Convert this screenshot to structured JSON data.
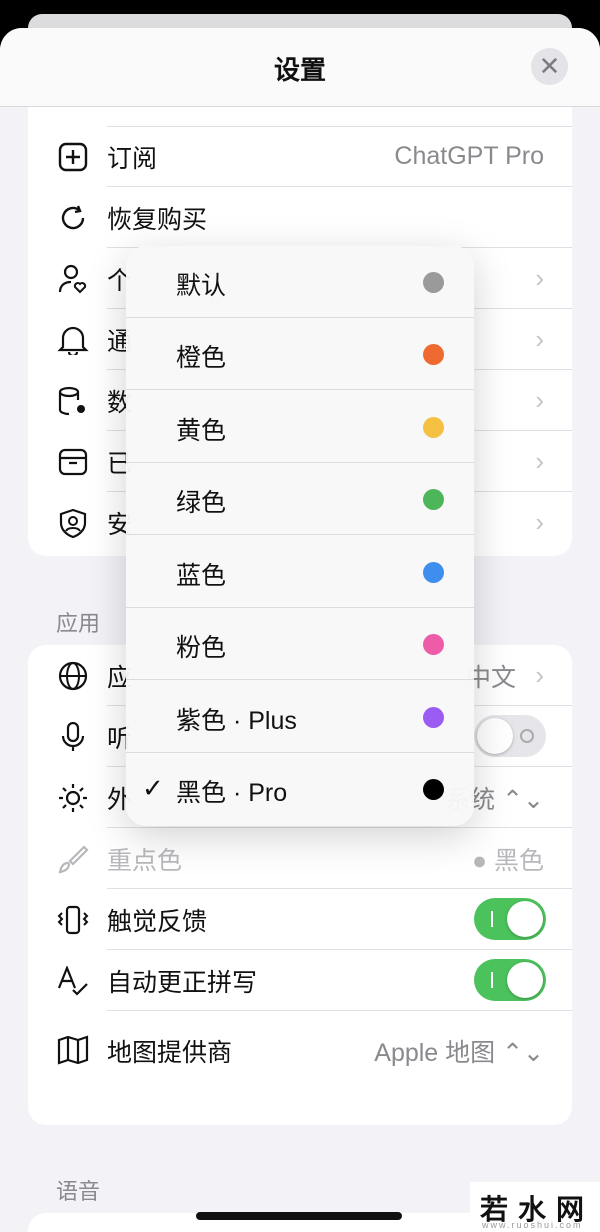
{
  "nav": {
    "title": "设置",
    "close_symbol": "✕"
  },
  "account_rows": [
    {
      "icon": "plus-square-icon",
      "label": "订阅",
      "value": "ChatGPT Pro"
    },
    {
      "icon": "refresh-icon",
      "label": "恢复购买"
    },
    {
      "icon": "personalization-icon",
      "label": "个"
    },
    {
      "icon": "bell-icon",
      "label": "通"
    },
    {
      "icon": "database-gear-icon",
      "label": "数"
    },
    {
      "icon": "archive-icon",
      "label": "已"
    },
    {
      "icon": "shield-icon",
      "label": "安"
    }
  ],
  "chevron": "›",
  "app_section": {
    "title": "应用",
    "rows": [
      {
        "icon": "globe-icon",
        "label": "应",
        "value": "中文"
      },
      {
        "icon": "microphone-icon",
        "label": "听"
      },
      {
        "icon": "sun-icon",
        "label": "外",
        "value": "系统 ⌃⌄"
      },
      {
        "icon": "paintbrush-icon",
        "label": "重点色",
        "value": "● 黑色"
      },
      {
        "icon": "haptics-icon",
        "label": "触觉反馈"
      },
      {
        "icon": "spellcheck-icon",
        "label": "自动更正拼写"
      },
      {
        "icon": "map-icon",
        "label": "地图提供商",
        "value": "Apple 地图 ⌃⌄"
      }
    ]
  },
  "voice_section": {
    "title": "语音"
  },
  "accent_menu": {
    "check_symbol": "✓",
    "selected_index": 7,
    "items": [
      {
        "label": "默认",
        "color": "#9a9a9a"
      },
      {
        "label": "橙色",
        "color": "#ee6a30"
      },
      {
        "label": "黄色",
        "color": "#f6c043"
      },
      {
        "label": "绿色",
        "color": "#4db55a"
      },
      {
        "label": "蓝色",
        "color": "#3e8ef0"
      },
      {
        "label": "粉色",
        "color": "#ee5ca8"
      },
      {
        "label": "紫色 · Plus",
        "color": "#9b5cf3"
      },
      {
        "label": "黑色 · Pro",
        "color": "#000000"
      }
    ]
  },
  "watermark": {
    "text": "若水网",
    "sub": "www.ruoshui.com"
  },
  "colors": {
    "toggle_on": "#4cc25c",
    "background": "#f2f2f7"
  }
}
